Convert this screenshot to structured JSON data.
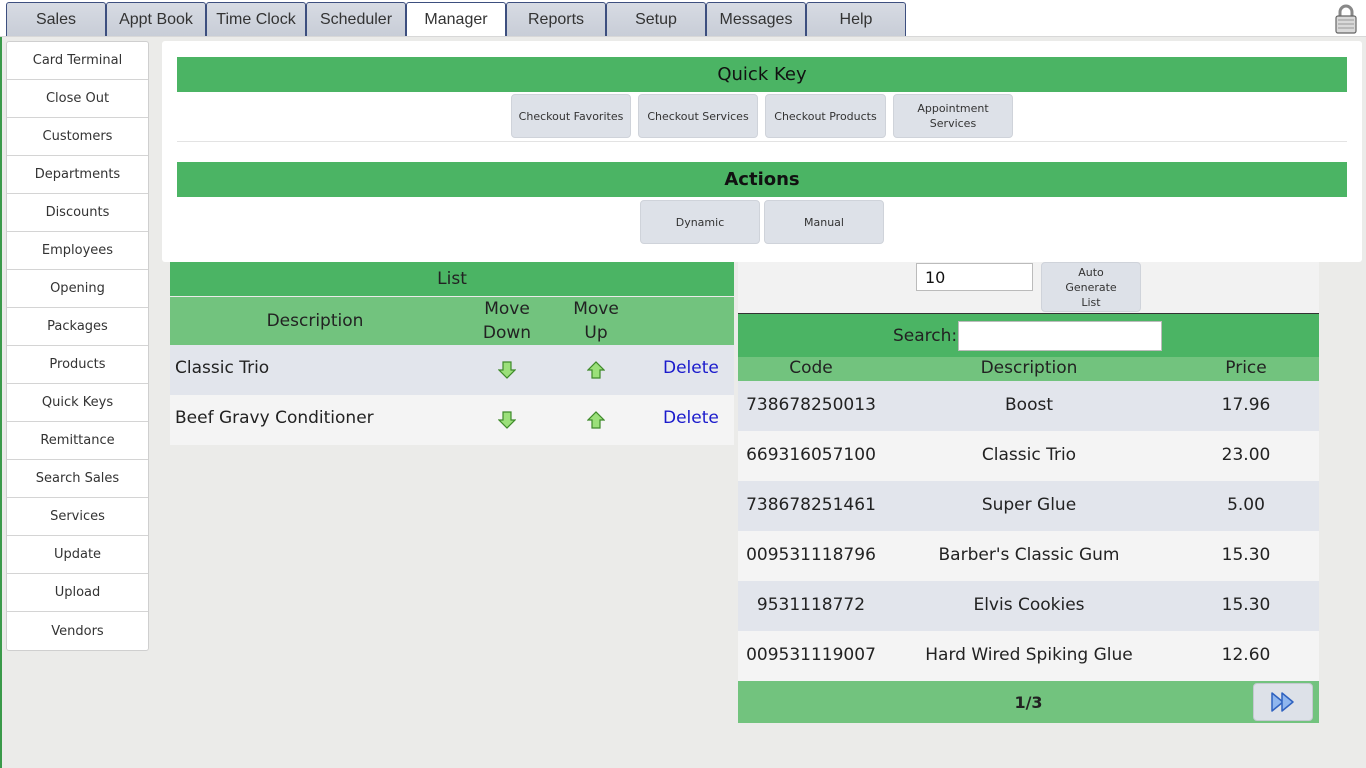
{
  "nav": {
    "tabs": [
      {
        "label": "Sales"
      },
      {
        "label": "Appt Book"
      },
      {
        "label": "Time Clock"
      },
      {
        "label": "Scheduler"
      },
      {
        "label": "Manager"
      },
      {
        "label": "Reports"
      },
      {
        "label": "Setup"
      },
      {
        "label": "Messages"
      },
      {
        "label": "Help"
      }
    ],
    "active_tab": "Manager"
  },
  "sidebar": {
    "items": [
      {
        "label": "Card Terminal"
      },
      {
        "label": "Close Out"
      },
      {
        "label": "Customers"
      },
      {
        "label": "Departments"
      },
      {
        "label": "Discounts"
      },
      {
        "label": "Employees"
      },
      {
        "label": "Opening"
      },
      {
        "label": "Packages"
      },
      {
        "label": "Products"
      },
      {
        "label": "Quick Keys"
      },
      {
        "label": "Remittance"
      },
      {
        "label": "Search Sales"
      },
      {
        "label": "Services"
      },
      {
        "label": "Update"
      },
      {
        "label": "Upload"
      },
      {
        "label": "Vendors"
      }
    ]
  },
  "quick_key": {
    "title": "Quick Key",
    "buttons": [
      {
        "label": "Checkout Favorites"
      },
      {
        "label": "Checkout Services"
      },
      {
        "label": "Checkout Products"
      },
      {
        "label": "Appointment Services"
      }
    ]
  },
  "actions": {
    "title": "Actions",
    "buttons": [
      {
        "label": "Dynamic"
      },
      {
        "label": "Manual"
      }
    ]
  },
  "list": {
    "title": "List",
    "columns": {
      "description": "Description",
      "move_down": "Move Down",
      "move_up": "Move Up"
    },
    "rows": [
      {
        "description": "Classic Trio",
        "delete": "Delete"
      },
      {
        "description": "Beef Gravy Conditioner",
        "delete": "Delete"
      }
    ]
  },
  "generator": {
    "count_value": "10",
    "auto_generate_label": "Auto Generate List"
  },
  "products": {
    "search_label": "Search:",
    "search_value": "",
    "columns": {
      "code": "Code",
      "description": "Description",
      "price": "Price"
    },
    "rows": [
      {
        "code": "738678250013",
        "description": "Boost",
        "price": "17.96"
      },
      {
        "code": "669316057100",
        "description": "Classic Trio",
        "price": "23.00"
      },
      {
        "code": "738678251461",
        "description": "Super Glue",
        "price": "5.00"
      },
      {
        "code": "009531118796",
        "description": "Barber's Classic Gum",
        "price": "15.30"
      },
      {
        "code": "9531118772",
        "description": "Elvis Cookies",
        "price": "15.30"
      },
      {
        "code": "009531119007",
        "description": "Hard Wired Spiking Glue",
        "price": "12.60"
      }
    ],
    "page": "1/3"
  },
  "colors": {
    "header_green": "#4bb464",
    "subheader_green": "#72c37e",
    "link_blue": "#1a1acc"
  }
}
